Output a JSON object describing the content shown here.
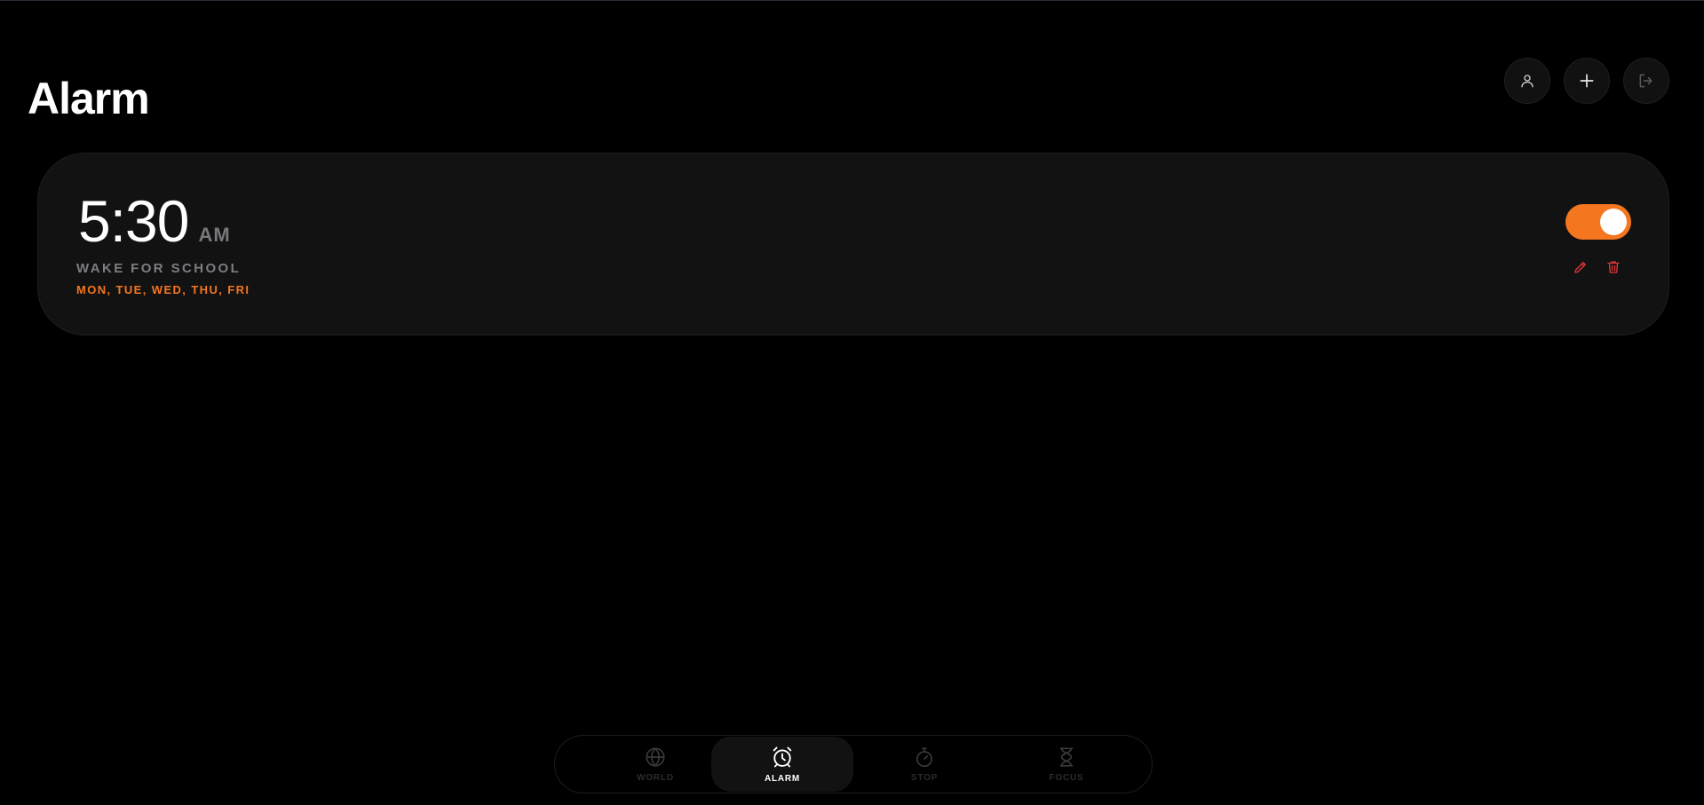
{
  "header": {
    "title": "Alarm",
    "actions": [
      {
        "icon": "user-icon"
      },
      {
        "icon": "plus-icon"
      },
      {
        "icon": "logout-icon"
      }
    ]
  },
  "alarms": [
    {
      "time": "5:30",
      "period": "AM",
      "label": "WAKE FOR SCHOOL",
      "days": "MON, TUE, WED, THU, FRI",
      "enabled": true,
      "edit_icon": "pencil-icon",
      "delete_icon": "trash-icon"
    }
  ],
  "nav": {
    "active": "alarm",
    "items": [
      {
        "id": "world",
        "label": "WORLD",
        "icon": "globe-icon"
      },
      {
        "id": "alarm",
        "label": "ALARM",
        "icon": "alarm-clock-icon"
      },
      {
        "id": "stop",
        "label": "STOP",
        "icon": "stopwatch-icon"
      },
      {
        "id": "focus",
        "label": "FOCUS",
        "icon": "hourglass-icon"
      }
    ]
  },
  "colors": {
    "accent": "#f4761f",
    "background": "#000000",
    "card": "#121212",
    "muted_text": "#7d7d82",
    "delete": "#e0353a"
  }
}
